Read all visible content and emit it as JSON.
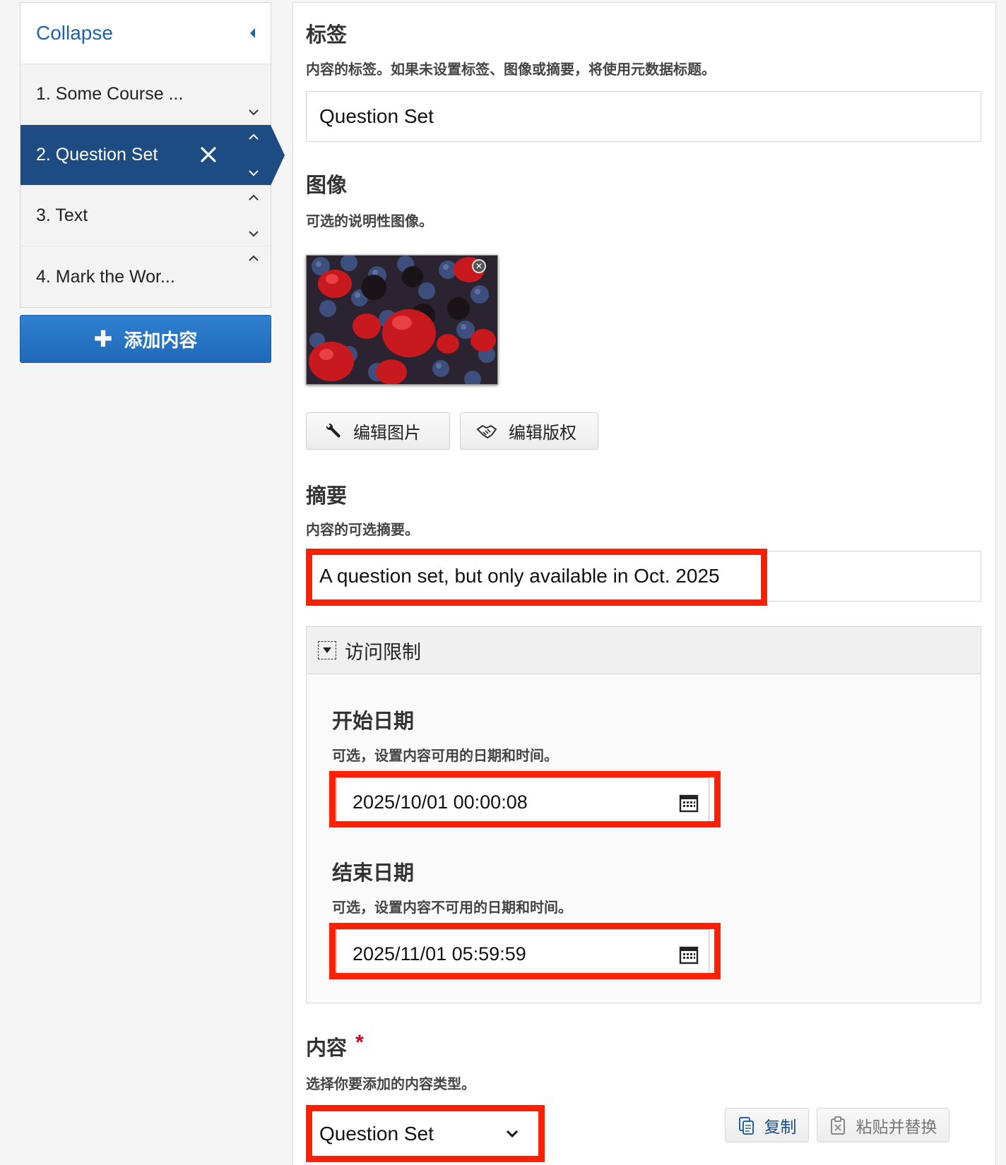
{
  "sidebar": {
    "collapse_label": "Collapse",
    "items": [
      {
        "label": "1. Some Course ..."
      },
      {
        "label": "2. Question Set"
      },
      {
        "label": "3. Text"
      },
      {
        "label": "4. Mark the Wor..."
      }
    ],
    "add_button_label": "添加内容"
  },
  "label_field": {
    "title": "标签",
    "description": "内容的标签。如果未设置标签、图像或摘要，将使用元数据标题。",
    "value": "Question Set"
  },
  "image_field": {
    "title": "图像",
    "description": "可选的说明性图像。",
    "edit_image_label": "编辑图片",
    "edit_copyright_label": "编辑版权"
  },
  "summary_field": {
    "title": "摘要",
    "description": "内容的可选摘要。",
    "value": "A question set, but only available in Oct. 2025"
  },
  "access_restriction": {
    "title": "访问限制",
    "start": {
      "title": "开始日期",
      "description": "可选，设置内容可用的日期和时间。",
      "value": "2025/10/01 00:00:08"
    },
    "end": {
      "title": "结束日期",
      "description": "可选，设置内容不可用的日期和时间。",
      "value": "2025/11/01 05:59:59"
    }
  },
  "content_field": {
    "title": "内容",
    "required_mark": "*",
    "description": "选择你要添加的内容类型。",
    "selected": "Question Set",
    "copy_label": "复制",
    "paste_replace_label": "粘贴并替换"
  },
  "colors": {
    "accent": "#2163a8",
    "active_item": "#1d4c82",
    "highlight": "#ff2000",
    "required": "#d0021b"
  }
}
